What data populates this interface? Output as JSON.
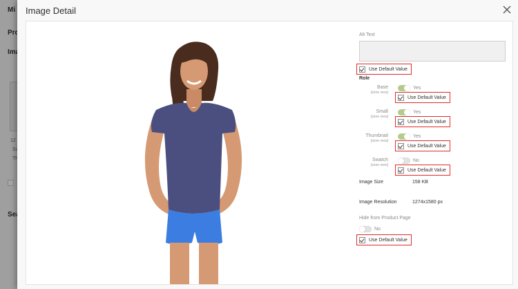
{
  "background": {
    "title_fragment": "Mi",
    "section_1": "Pro",
    "section_2": "Ima",
    "section_3": "Sea",
    "small_1": "12",
    "small_2": "Su",
    "small_3": "Th"
  },
  "modal": {
    "title": "Image Detail",
    "close_icon": "close-icon"
  },
  "panel": {
    "alt_text_label": "Alt Text",
    "alt_text_value": "",
    "use_default_label": "Use Default Value",
    "role_heading": "Role",
    "store_view": "[store view]",
    "roles": [
      {
        "name": "Base",
        "state": "Yes",
        "enabled": true
      },
      {
        "name": "Small",
        "state": "Yes",
        "enabled": true
      },
      {
        "name": "Thumbnail",
        "state": "Yes",
        "enabled": true
      },
      {
        "name": "Swatch",
        "state": "No",
        "enabled": false
      }
    ],
    "image_size_label": "Image Size",
    "image_size_value": "158 KB",
    "image_resolution_label": "Image Resolution",
    "image_resolution_value": "1274x1580 px",
    "hide_label": "Hide from Product Page",
    "hide_state": "No"
  },
  "colors": {
    "accent_red": "#e02b27",
    "toggle_on": "#79a22e",
    "shirt": "#4a4f80",
    "shorts": "#3b7de0"
  }
}
